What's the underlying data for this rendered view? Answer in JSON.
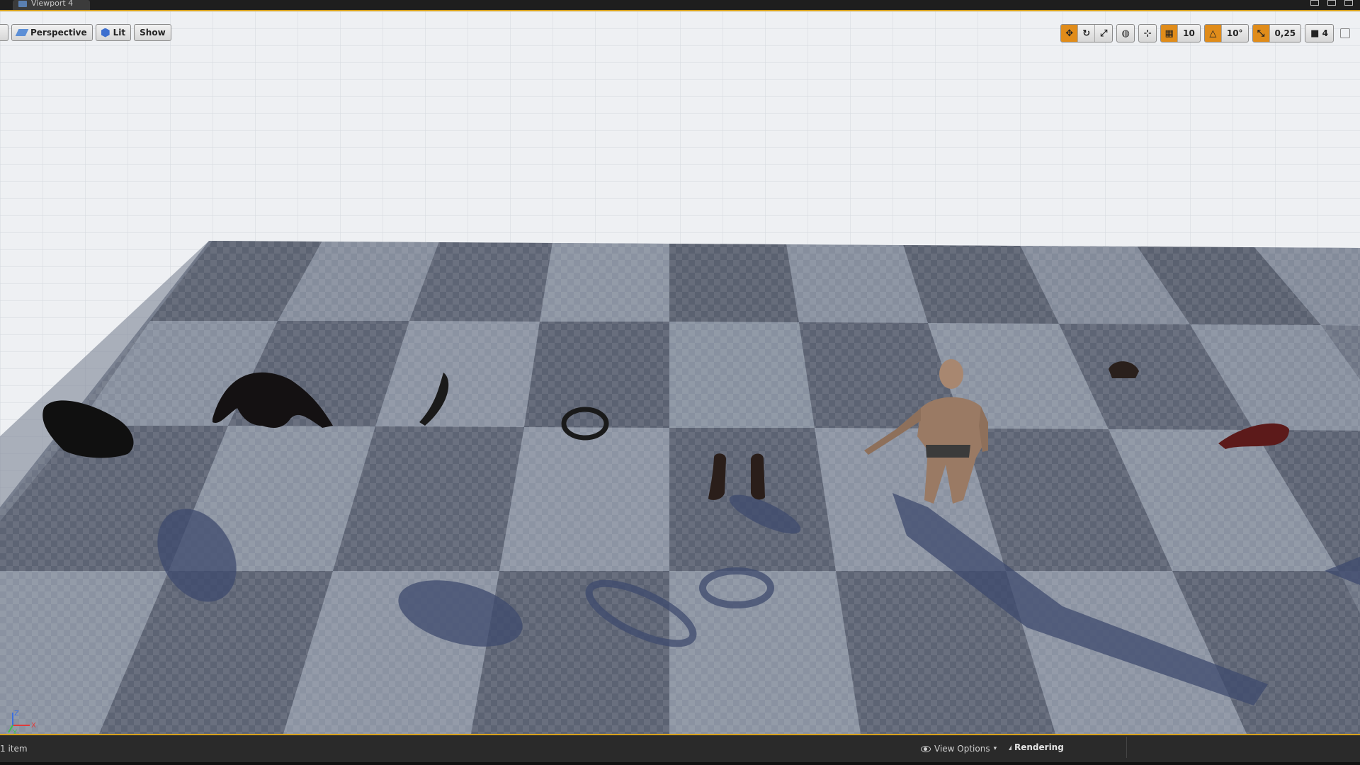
{
  "window": {
    "tab_title": "Viewport 4"
  },
  "toolbar_left": {
    "perspective_label": "Perspective",
    "lit_label": "Lit",
    "show_label": "Show"
  },
  "toolbar_right": {
    "grid_snap_value": "10",
    "rotation_snap_value": "10°",
    "scale_snap_value": "0,25",
    "camera_speed_value": "4"
  },
  "axis": {
    "x": "X",
    "y": "Y",
    "z": "Z"
  },
  "statusbar": {
    "item_count": "1 item",
    "view_options_label": "View Options",
    "rendering_label": "Rendering"
  },
  "colors": {
    "accent": "#d8a21c",
    "active_tool": "#e08c1a",
    "checker_dark": "#5c6372",
    "checker_light": "#878f9e",
    "grid_bg": "#eef0f3"
  },
  "scene": {
    "objects": [
      "hood-mesh",
      "jacket-mesh",
      "strap-mesh",
      "belt-mesh",
      "boots-mesh",
      "character-mannequin",
      "hair-mesh",
      "collar-mesh"
    ]
  }
}
